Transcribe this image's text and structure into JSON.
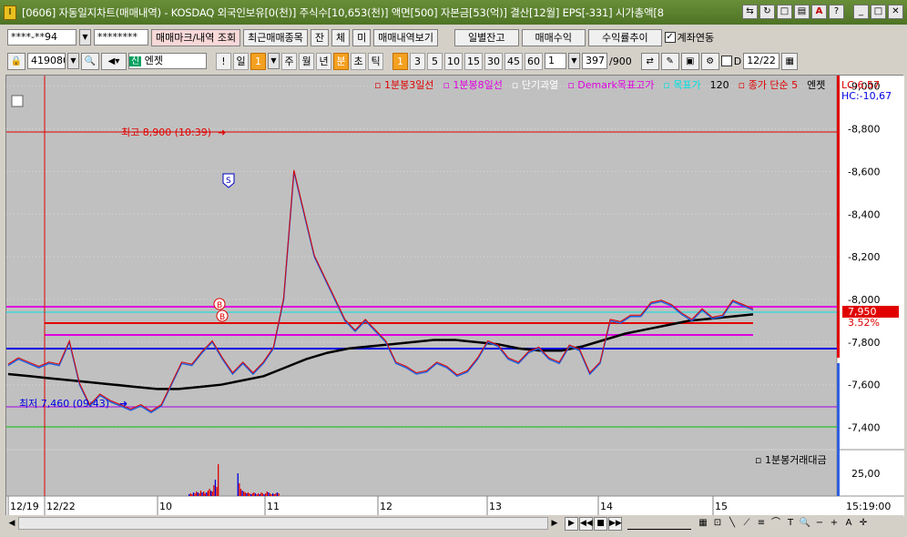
{
  "window": {
    "title": "[0606] 자동일지차트(매매내역) - KOSDAQ 외국인보유[0(천)] 주식수[10,653(천)] 액면[500] 자본금[53(억)] 결산[12월] EPS[-331] 시가총액[8",
    "icon": "I"
  },
  "toolbar1": {
    "account": "****-**94",
    "password": "********",
    "btn_trade_mark": "매매마크/내역 조회",
    "btn_recent": "최근매매종목",
    "btn_jan": "잔",
    "btn_che": "체",
    "btn_mi": "미",
    "btn_view_trades": "매매내역보기",
    "btn_daily_balance": "일별잔고",
    "btn_profit": "매매수익",
    "btn_return_trend": "수익률추이",
    "account_link_label": "계좌연동",
    "account_link_checked": "✓"
  },
  "toolbar2": {
    "code": "419080",
    "badge": "신",
    "name": "엔젯",
    "exclaim": "!",
    "period_day": "일",
    "period_num": "1",
    "period_week": "주",
    "period_month": "월",
    "period_year": "년",
    "period_min": "분",
    "period_sec": "초",
    "period_tick": "틱",
    "minutes": [
      "1",
      "3",
      "5",
      "10",
      "15",
      "30",
      "45",
      "60"
    ],
    "count_value": "1",
    "count_display": "397",
    "count_total": "/900",
    "d_label": "D",
    "date_value": "12/22"
  },
  "legend": {
    "items": [
      {
        "label": "1분봉3일선",
        "color": "#e00000"
      },
      {
        "label": "1분봉8일선",
        "color": "#e000e0"
      },
      {
        "label": "단기과열",
        "color": "#ffffff"
      },
      {
        "label": "Demark목표고가",
        "color": "#e000e0"
      },
      {
        "label": "목표가",
        "color": "#00e0e0"
      },
      {
        "label": "120",
        "color": "#000000"
      },
      {
        "label": "종가 단순 5",
        "color": "#e00000"
      },
      {
        "label": "엔젯",
        "color": "#000000"
      }
    ],
    "volume_label": "1분봉거래대금"
  },
  "chart_data": {
    "type": "line",
    "price_axis": [
      "9,000",
      "8,800",
      "8,600",
      "8,400",
      "8,200",
      "8,000",
      "7,800",
      "7,600",
      "7,400"
    ],
    "ylim": [
      7300,
      9050
    ],
    "lc_label": "LC:6,57",
    "hc_label": "HC:-10,67",
    "current_price": "7,950",
    "current_pct": "3.52%",
    "high_annotation": "최고 8,900 (10:39)",
    "low_annotation": "최저 7,460 (09:43)",
    "high_value": 8900,
    "low_value": 7460,
    "volume_axis_label": "25,00",
    "time_label": "15:19:00",
    "x_labels": [
      "12/19",
      "12/22",
      "10",
      "11",
      "12",
      "13",
      "14",
      "15"
    ],
    "markers": [
      "S",
      "B",
      "B"
    ],
    "series": [
      {
        "values": [
          7690,
          7720,
          7700,
          7680,
          7700,
          7690,
          7800,
          7600,
          7500,
          7550,
          7520,
          7500,
          7480,
          7500,
          7470,
          7500,
          7600,
          7700,
          7690,
          7750,
          7800,
          7720,
          7650,
          7700,
          7650,
          7700,
          7770,
          8000,
          8600,
          8400,
          8200,
          8100,
          8000,
          7900,
          7850,
          7900,
          7850,
          7800,
          7700,
          7680,
          7650,
          7660,
          7700,
          7680,
          7640,
          7660,
          7720,
          7800,
          7780,
          7720,
          7700,
          7750,
          7770,
          7720,
          7700,
          7780,
          7760,
          7650,
          7700,
          7900,
          7890,
          7920,
          7920,
          7980,
          7990,
          7970,
          7930,
          7900,
          7950,
          7910,
          7920,
          7990,
          7970,
          7950
        ]
      },
      {
        "values": [
          7650,
          7640,
          7630,
          7620,
          7610,
          7600,
          7590,
          7580,
          7580,
          7590,
          7600,
          7620,
          7640,
          7680,
          7720,
          7750,
          7770,
          7780,
          7790,
          7800,
          7810,
          7810,
          7800,
          7790,
          7770,
          7760,
          7760,
          7780,
          7810,
          7840,
          7860,
          7880,
          7900,
          7910,
          7920,
          7930
        ]
      }
    ]
  },
  "status": {
    "colors": {
      "accent": "#f4a020",
      "window": "#4e7424"
    }
  }
}
